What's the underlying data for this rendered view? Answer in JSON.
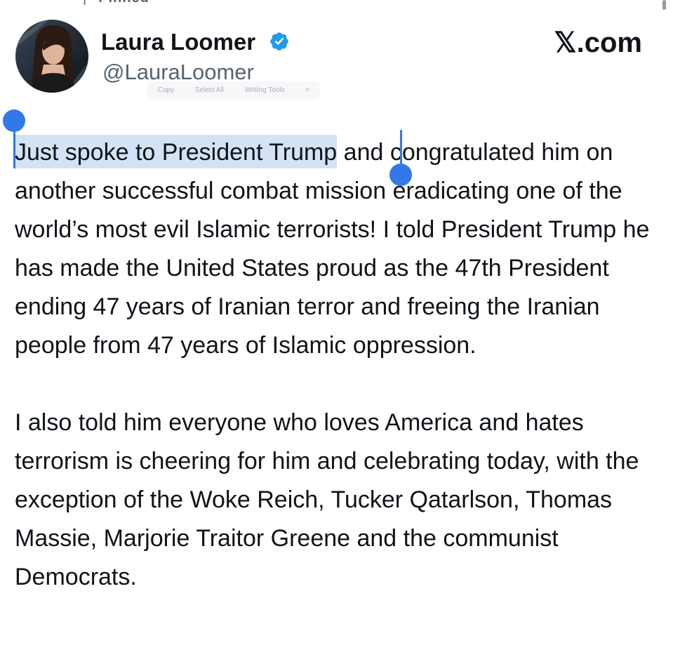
{
  "header": {
    "pinned_label": "Pinned",
    "scroll_indicator": true
  },
  "author": {
    "name": "Laura Loomer",
    "handle": "@LauraLoomer",
    "verified": true
  },
  "source": {
    "label": "𝕏.com"
  },
  "edit_menu": {
    "items": [
      "Copy",
      "Select All",
      "Writing Tools",
      ">"
    ]
  },
  "tweet": {
    "paragraph1_selected": "Just spoke to President Trump",
    "paragraph1_rest": " and congratulated him on another successful combat mission eradicating one of the world’s most evil Islamic terrorists! I told President Trump he has made the United States proud as the 47th President ending 47 years of Iranian terror and freeing the Iranian people from 47 years of Islamic oppression.",
    "paragraph2": "I also told him everyone who loves America and hates terrorism is cheering for him and celebrating today, with the exception of the Woke Reich, Tucker Qatarlson, Thomas Massie, Marjorie Traitor Greene and the communist Democrats."
  },
  "colors": {
    "text": "#0f1419",
    "secondary_text": "#536471",
    "verified_blue": "#1d9bf0",
    "selection_highlight": "#d4e2f5",
    "selection_handle": "#3378e8"
  }
}
